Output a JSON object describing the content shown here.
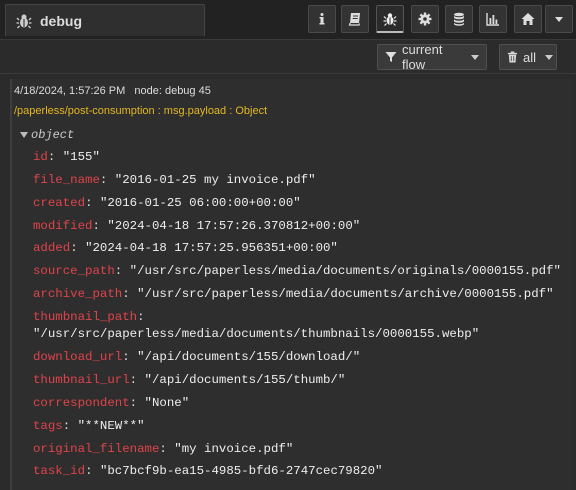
{
  "header": {
    "tab_title": "debug",
    "tools": [
      {
        "icon": "info-icon",
        "active": false
      },
      {
        "icon": "book-icon",
        "active": false
      },
      {
        "icon": "bug-icon",
        "active": true
      },
      {
        "icon": "gear-icon",
        "active": false
      },
      {
        "icon": "database-icon",
        "active": false
      },
      {
        "icon": "bar-chart-icon",
        "active": false
      },
      {
        "icon": "home-icon",
        "active": false
      }
    ]
  },
  "toolbar": {
    "filter_label": "current flow",
    "clear_label": "all"
  },
  "message": {
    "timestamp": "4/18/2024, 1:57:26 PM",
    "node": "node: debug 45",
    "topic": "/paperless/post-consumption : msg.payload : Object",
    "object_label": "object",
    "properties": [
      {
        "key": "id",
        "value": "\"155\""
      },
      {
        "key": "file_name",
        "value": "\"2016-01-25 my invoice.pdf\""
      },
      {
        "key": "created",
        "value": "\"2016-01-25 06:00:00+00:00\""
      },
      {
        "key": "modified",
        "value": "\"2024-04-18 17:57:26.370812+00:00\""
      },
      {
        "key": "added",
        "value": "\"2024-04-18 17:57:25.956351+00:00\""
      },
      {
        "key": "source_path",
        "value": "\"/usr/src/paperless/media/documents/originals/0000155.pdf\""
      },
      {
        "key": "archive_path",
        "value": "\"/usr/src/paperless/media/documents/archive/0000155.pdf\""
      },
      {
        "key": "thumbnail_path",
        "value": "\"/usr/src/paperless/media/documents/thumbnails/0000155.webp\""
      },
      {
        "key": "download_url",
        "value": "\"/api/documents/155/download/\""
      },
      {
        "key": "thumbnail_url",
        "value": "\"/api/documents/155/thumb/\""
      },
      {
        "key": "correspondent",
        "value": "\"None\""
      },
      {
        "key": "tags",
        "value": "\"**NEW**\""
      },
      {
        "key": "original_filename",
        "value": "\"my invoice.pdf\""
      },
      {
        "key": "task_id",
        "value": "\"bc7bcf9b-ea15-4985-bfd6-2747cec79820\""
      }
    ]
  },
  "colors": {
    "key": "#e0434b",
    "topic": "#e5b71f",
    "background": "#2b2b2b"
  }
}
